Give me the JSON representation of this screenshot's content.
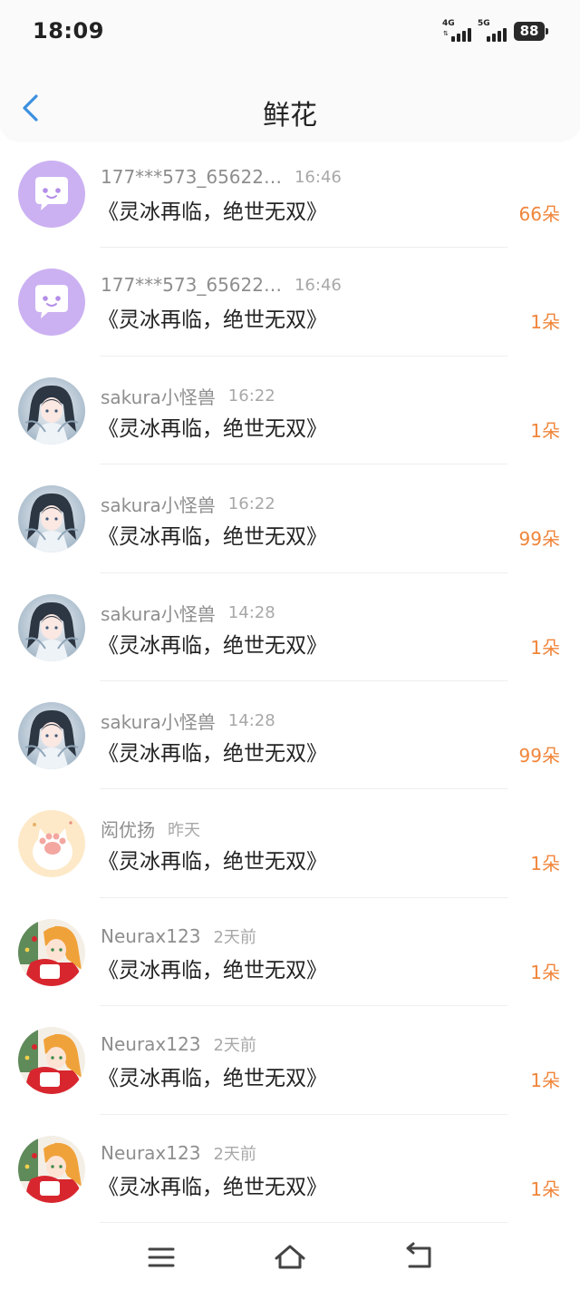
{
  "status_bar": {
    "time": "18:09",
    "signal_1": "4G",
    "signal_2": "5G",
    "battery": "88"
  },
  "header": {
    "title": "鲜花"
  },
  "items": [
    {
      "sender": "177***573_65622…",
      "time": "16:46",
      "title": "《灵冰再临，绝世无双》",
      "count": "66朵",
      "avatar": "chat-bubble"
    },
    {
      "sender": "177***573_65622…",
      "time": "16:46",
      "title": "《灵冰再临，绝世无双》",
      "count": "1朵",
      "avatar": "chat-bubble"
    },
    {
      "sender": "sakura小怪兽",
      "time": "16:22",
      "title": "《灵冰再临，绝世无双》",
      "count": "1朵",
      "avatar": "anime-girl"
    },
    {
      "sender": "sakura小怪兽",
      "time": "16:22",
      "title": "《灵冰再临，绝世无双》",
      "count": "99朵",
      "avatar": "anime-girl"
    },
    {
      "sender": "sakura小怪兽",
      "time": "14:28",
      "title": "《灵冰再临，绝世无双》",
      "count": "1朵",
      "avatar": "anime-girl"
    },
    {
      "sender": "sakura小怪兽",
      "time": "14:28",
      "title": "《灵冰再临，绝世无双》",
      "count": "99朵",
      "avatar": "anime-girl"
    },
    {
      "sender": "闳优扬",
      "time": "昨天",
      "title": "《灵冰再临，绝世无双》",
      "count": "1朵",
      "avatar": "cat-paw"
    },
    {
      "sender": "Neurax123",
      "time": "2天前",
      "title": "《灵冰再临，绝世无双》",
      "count": "1朵",
      "avatar": "christmas-girl"
    },
    {
      "sender": "Neurax123",
      "time": "2天前",
      "title": "《灵冰再临，绝世无双》",
      "count": "1朵",
      "avatar": "christmas-girl"
    },
    {
      "sender": "Neurax123",
      "time": "2天前",
      "title": "《灵冰再临，绝世无双》",
      "count": "1朵",
      "avatar": "christmas-girl"
    }
  ],
  "bottom_nav": {
    "buttons": [
      "menu-icon",
      "home-icon",
      "back-icon"
    ]
  },
  "colors": {
    "accent": "#3b8fe0",
    "count": "#f0853a",
    "sender": "#8e8e8e",
    "title": "#222222"
  }
}
